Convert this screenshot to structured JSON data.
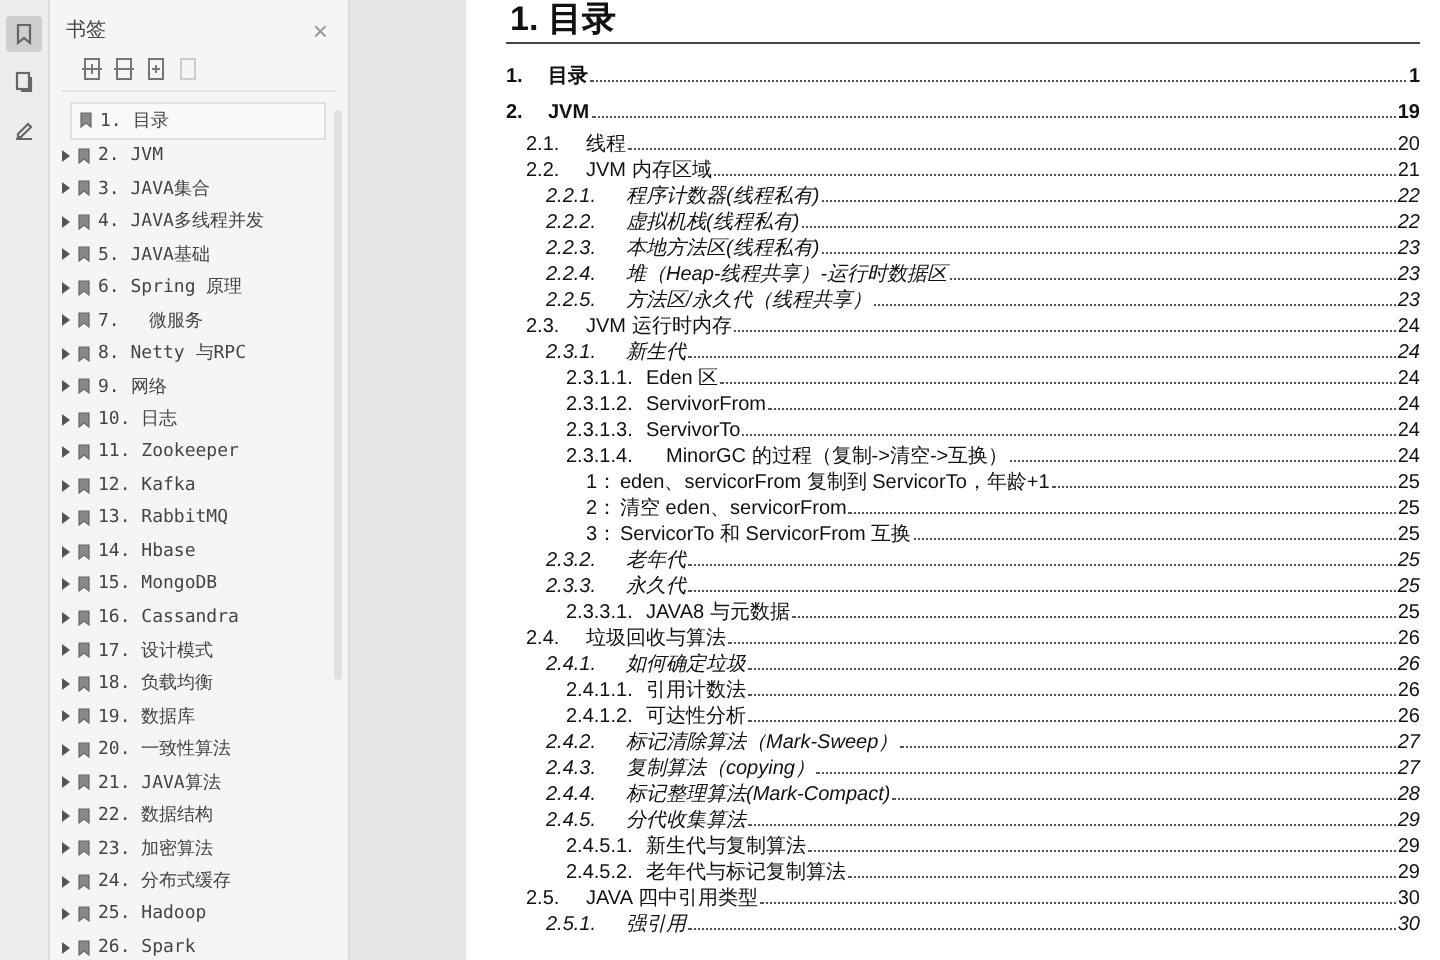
{
  "side_tools": [
    {
      "selected": true
    },
    {
      "selected": false
    },
    {
      "selected": false
    }
  ],
  "bookmarks_panel": {
    "title": "书签",
    "close": "×",
    "toolbar": [
      {
        "disabled": false
      },
      {
        "disabled": false
      },
      {
        "disabled": false
      },
      {
        "disabled": true
      }
    ],
    "items": [
      {
        "label": "1. 目录",
        "kind": "leaf",
        "selected": true
      },
      {
        "label": "2. JVM",
        "kind": "branch",
        "selected": false
      },
      {
        "label": "3. JAVA集合",
        "kind": "branch",
        "selected": false
      },
      {
        "label": "4. JAVA多线程并发",
        "kind": "branch",
        "selected": false
      },
      {
        "label": "5. JAVA基础",
        "kind": "branch",
        "selected": false
      },
      {
        "label": "6. Spring 原理",
        "kind": "branch",
        "selected": false
      },
      {
        "label": "7.　 微服务",
        "kind": "branch",
        "selected": false
      },
      {
        "label": "8. Netty 与RPC",
        "kind": "branch",
        "selected": false
      },
      {
        "label": "9. 网络",
        "kind": "branch",
        "selected": false
      },
      {
        "label": "10. 日志",
        "kind": "branch",
        "selected": false
      },
      {
        "label": "11. Zookeeper",
        "kind": "branch",
        "selected": false
      },
      {
        "label": "12. Kafka",
        "kind": "branch",
        "selected": false
      },
      {
        "label": "13. RabbitMQ",
        "kind": "branch",
        "selected": false
      },
      {
        "label": "14. Hbase",
        "kind": "branch",
        "selected": false
      },
      {
        "label": "15. MongoDB",
        "kind": "branch",
        "selected": false
      },
      {
        "label": "16. Cassandra",
        "kind": "branch",
        "selected": false
      },
      {
        "label": "17. 设计模式",
        "kind": "branch",
        "selected": false
      },
      {
        "label": "18. 负载均衡",
        "kind": "branch",
        "selected": false
      },
      {
        "label": "19. 数据库",
        "kind": "branch",
        "selected": false
      },
      {
        "label": "20. 一致性算法",
        "kind": "branch",
        "selected": false
      },
      {
        "label": "21. JAVA算法",
        "kind": "branch",
        "selected": false
      },
      {
        "label": "22. 数据结构",
        "kind": "branch",
        "selected": false
      },
      {
        "label": "23. 加密算法",
        "kind": "branch",
        "selected": false
      },
      {
        "label": "24. 分布式缓存",
        "kind": "branch",
        "selected": false
      },
      {
        "label": "25. Hadoop",
        "kind": "branch",
        "selected": false
      },
      {
        "label": "26. Spark",
        "kind": "branch",
        "selected": false
      }
    ]
  },
  "page": {
    "heading": "1. 目录",
    "toc": [
      {
        "number": "1.",
        "title": "目录",
        "page": "1"
      },
      {
        "number": "2.",
        "title": "JVM",
        "page": "19",
        "children": [
          {
            "number": "2.1.",
            "title": "线程",
            "page": "20"
          },
          {
            "number": "2.2.",
            "title": "JVM 内存区域",
            "page": "21",
            "children": [
              {
                "number": "2.2.1.",
                "title": "程序计数器(线程私有)",
                "page": "22"
              },
              {
                "number": "2.2.2.",
                "title": "虚拟机栈(线程私有)",
                "page": "22"
              },
              {
                "number": "2.2.3.",
                "title": "本地方法区(线程私有)",
                "page": "23"
              },
              {
                "number": "2.2.4.",
                "title": "堆（Heap-线程共享）-运行时数据区",
                "page": "23"
              },
              {
                "number": "2.2.5.",
                "title": "方法区/永久代（线程共享）",
                "page": "23"
              }
            ]
          },
          {
            "number": "2.3.",
            "title": "JVM 运行时内存",
            "page": "24",
            "children": [
              {
                "number": "2.3.1.",
                "title": "新生代",
                "page": "24",
                "children": [
                  {
                    "number": "2.3.1.1.",
                    "title": "Eden 区",
                    "page": "24"
                  },
                  {
                    "number": "2.3.1.2.",
                    "title": "ServivorFrom",
                    "page": "24"
                  },
                  {
                    "number": "2.3.1.3.",
                    "title": "ServivorTo",
                    "page": "24"
                  },
                  {
                    "number": "2.3.1.4.",
                    "title": "MinorGC 的过程（复制->清空->互换）",
                    "page": "24",
                    "children": [
                      {
                        "number": "1：",
                        "title": "eden、servicorFrom 复制到 ServicorTo，年龄+1",
                        "page": "25"
                      },
                      {
                        "number": "2：",
                        "title": "清空 eden、servicorFrom",
                        "page": "25"
                      },
                      {
                        "number": "3：",
                        "title": "ServicorTo 和 ServicorFrom 互换",
                        "page": "25"
                      }
                    ]
                  }
                ]
              },
              {
                "number": "2.3.2.",
                "title": "老年代",
                "page": "25"
              },
              {
                "number": "2.3.3.",
                "title": "永久代",
                "page": "25",
                "children": [
                  {
                    "number": "2.3.3.1.",
                    "title": "JAVA8 与元数据",
                    "page": "25"
                  }
                ]
              }
            ]
          },
          {
            "number": "2.4.",
            "title": "垃圾回收与算法",
            "page": "26",
            "children": [
              {
                "number": "2.4.1.",
                "title": "如何确定垃圾",
                "page": "26",
                "children": [
                  {
                    "number": "2.4.1.1.",
                    "title": "引用计数法",
                    "page": "26"
                  },
                  {
                    "number": "2.4.1.2.",
                    "title": "可达性分析",
                    "page": "26"
                  }
                ]
              },
              {
                "number": "2.4.2.",
                "title": "标记清除算法（Mark-Sweep）",
                "page": "27"
              },
              {
                "number": "2.4.3.",
                "title": "复制算法（copying）",
                "page": "27"
              },
              {
                "number": "2.4.4.",
                "title": "标记整理算法(Mark-Compact)",
                "page": "28"
              },
              {
                "number": "2.4.5.",
                "title": "分代收集算法",
                "page": "29",
                "children": [
                  {
                    "number": "2.4.5.1.",
                    "title": "新生代与复制算法",
                    "page": "29"
                  },
                  {
                    "number": "2.4.5.2.",
                    "title": "老年代与标记复制算法",
                    "page": "29"
                  }
                ]
              }
            ]
          },
          {
            "number": "2.5.",
            "title": "JAVA 四中引用类型",
            "page": "30",
            "children": [
              {
                "number": "2.5.1.",
                "title": "强引用",
                "page": "30"
              }
            ]
          }
        ]
      }
    ]
  }
}
